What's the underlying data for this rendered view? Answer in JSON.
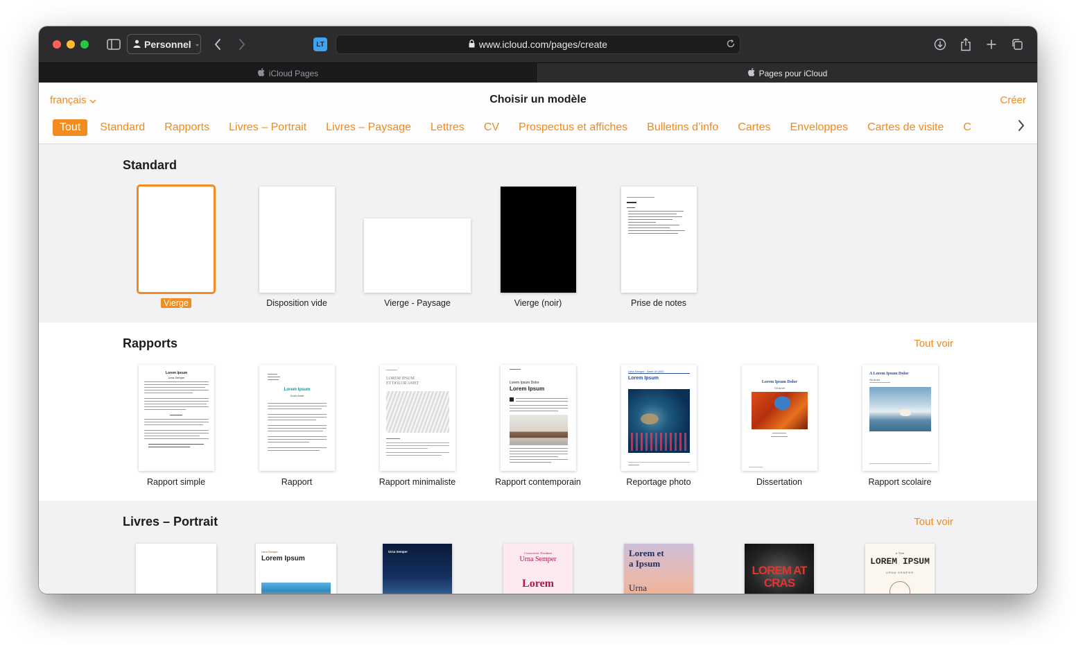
{
  "browser": {
    "profile_label": "Personnel",
    "url": "www.icloud.com/pages/create",
    "extension_label": "LT",
    "tabs": [
      {
        "label": "iCloud Pages"
      },
      {
        "label": "Pages pour iCloud"
      }
    ]
  },
  "header": {
    "language": "français",
    "title": "Choisir un modèle",
    "create_label": "Créer"
  },
  "categories": [
    "Tout",
    "Standard",
    "Rapports",
    "Livres – Portrait",
    "Livres – Paysage",
    "Lettres",
    "CV",
    "Prospectus et affiches",
    "Bulletins d’info",
    "Cartes",
    "Enveloppes",
    "Cartes de visite",
    "C"
  ],
  "active_category": "Tout",
  "sections": {
    "standard": {
      "title": "Standard",
      "templates": [
        "Vierge",
        "Disposition vide",
        "Vierge - Paysage",
        "Vierge (noir)",
        "Prise de notes"
      ]
    },
    "rapports": {
      "title": "Rapports",
      "see_all": "Tout voir",
      "templates": [
        "Rapport simple",
        "Rapport",
        "Rapport minimaliste",
        "Rapport contemporain",
        "Reportage photo",
        "Dissertation",
        "Rapport scolaire"
      ]
    },
    "livres": {
      "title": "Livres – Portrait",
      "see_all": "Tout voir"
    }
  },
  "thumb_text": {
    "simple_title": "Lorem Ipsum",
    "simple_sub": "Urna Semper",
    "rapport_title": "Lorem Ipsum",
    "rapport_sub": "Dolor Amet",
    "min_heading1": "LOREM IPSUM",
    "min_heading2": "ET DOLOR AMET",
    "contemp_small": "Lorem Ipsum Dolor",
    "contemp_title": "Lorem Ipsum",
    "photo_kicker": "Urna Semper · Amet Ut 2020",
    "photo_title": "Lorem Ipsum",
    "diss_title": "Lorem Ipsum Dolor",
    "diss_sub": "Sit Amet",
    "scol_title": "A Lorem Ipsum Dolor",
    "scol_sub": "Sit Amet",
    "book2_kicker": "Urna Semper",
    "book2_title": "Lorem Ipsum",
    "book3_title": "Urna Semper",
    "book4_kicker": "Consectetur Tincidunt",
    "book4_title": "Urna Semper",
    "book4_big": "Lorem",
    "book5_title": "Lorem et a Ipsum",
    "book5_sub": "Urna",
    "book6_title": "LOREM AT CRAS",
    "book7_kicker": "A Time",
    "book7_title": "LOREM IPSUM",
    "book7_sub": "URNA SEMPER"
  }
}
